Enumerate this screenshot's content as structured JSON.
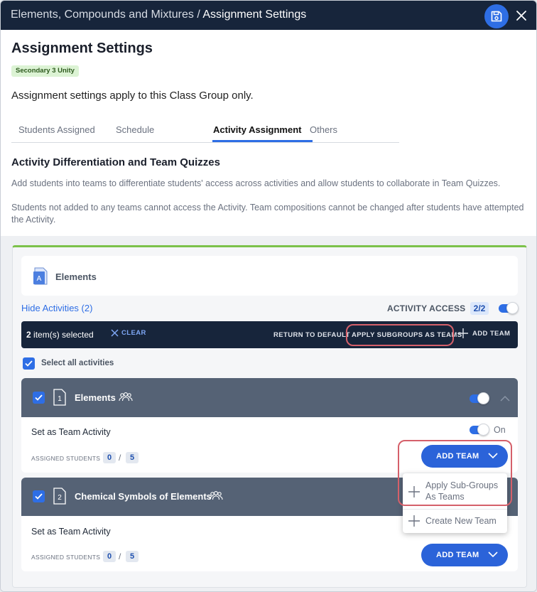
{
  "header": {
    "breadcrumb_parent": "Elements, Compounds and Mixtures",
    "breadcrumb_separator": " / ",
    "breadcrumb_current": "Assignment Settings"
  },
  "page": {
    "title": "Assignment Settings",
    "class_badge": "Secondary 3 Unity",
    "scope_note": "Assignment settings apply to this Class Group only."
  },
  "tabs": [
    {
      "label": "Students Assigned",
      "active": false
    },
    {
      "label": "Schedule",
      "active": false
    },
    {
      "label": "Activity Assignment",
      "active": true
    },
    {
      "label": "Others",
      "active": false
    }
  ],
  "section": {
    "title": "Activity Differentiation and Team Quizzes",
    "desc1": "Add students into teams to differentiate students' access across activities and allow students to collaborate in Team Quizzes.",
    "desc2": "Students not added to any teams cannot access the Activity. Team compositions cannot be changed after students have attempted the Activity."
  },
  "activity": {
    "icon_letter": "A",
    "name": "Elements",
    "hide_link": "Hide Activities (2)",
    "access_label": "ACTIVITY ACCESS",
    "access_count": "2/2",
    "access_enabled": true
  },
  "selection_bar": {
    "count_bold": "2",
    "count_rest": " item(s) selected",
    "clear": "CLEAR",
    "return_default": "RETURN TO DEFAULT",
    "apply_subgroups": "APPLY SUBGROUPS AS TEAMS",
    "add_team": "ADD TEAM"
  },
  "select_all": "Select all activities",
  "cards": [
    {
      "number": "1",
      "title": "Elements",
      "enabled": true,
      "team_activity_label": "Set as Team Activity",
      "team_activity_state": "On",
      "assigned_label": "ASSIGNED STUDENTS",
      "assigned": "0",
      "total": "5",
      "add_team_label": "ADD TEAM"
    },
    {
      "number": "2",
      "title": "Chemical Symbols of Elements",
      "enabled": true,
      "team_activity_label": "Set as Team Activity",
      "assigned_label": "ASSIGNED STUDENTS",
      "assigned": "0",
      "total": "5",
      "add_team_label": "ADD TEAM"
    }
  ],
  "dropdown": {
    "apply_line1": "Apply Sub-Groups",
    "apply_line2": "As Teams",
    "create": "Create New Team"
  },
  "colors": {
    "primary": "#2e6ee5",
    "navbar": "#17253b",
    "card_header": "#556275",
    "highlight_ring": "#d5606a",
    "panel_accent": "#7cc24a"
  }
}
